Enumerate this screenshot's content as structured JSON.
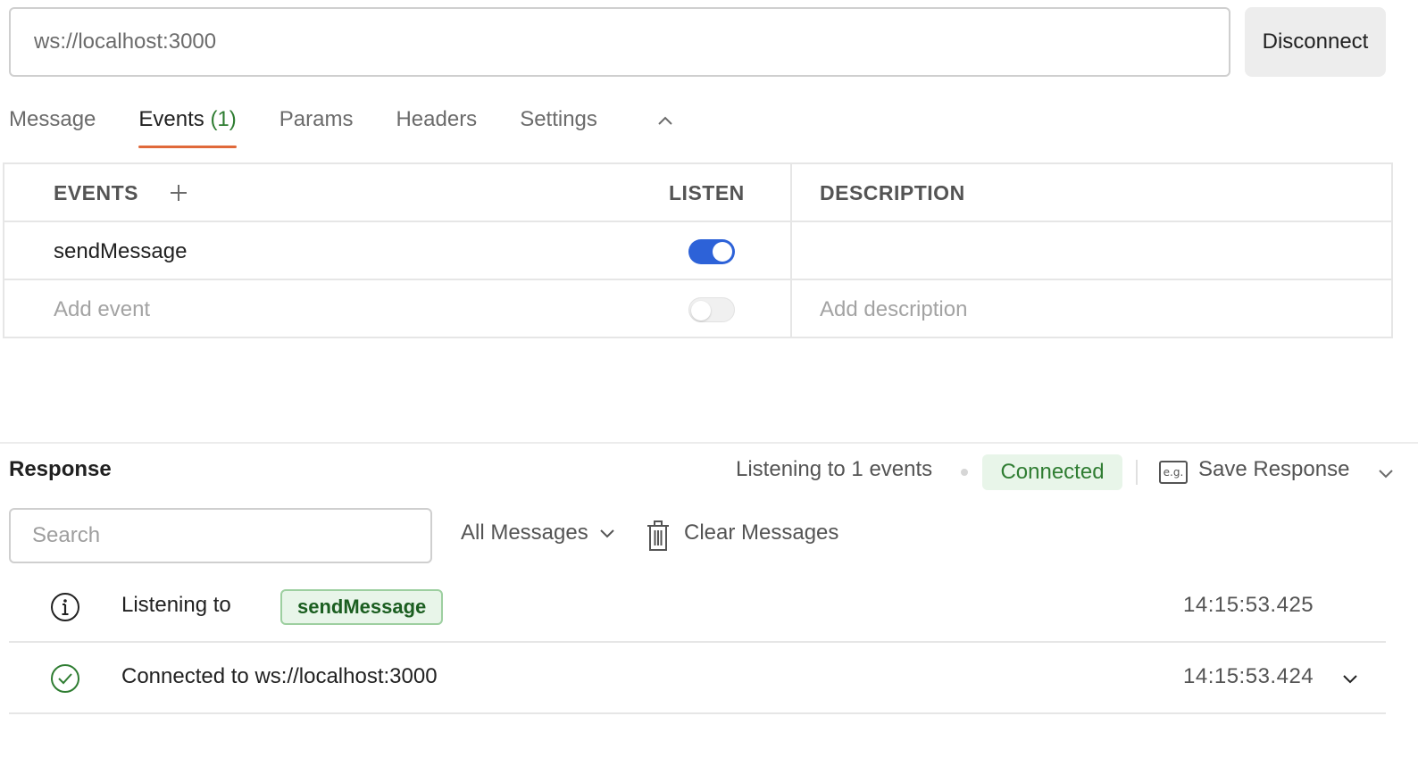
{
  "request": {
    "url": "ws://localhost:3000",
    "disconnect_label": "Disconnect"
  },
  "tabs": [
    {
      "label": "Message",
      "count": ""
    },
    {
      "label": "Events",
      "count": "(1)"
    },
    {
      "label": "Params",
      "count": ""
    },
    {
      "label": "Headers",
      "count": ""
    },
    {
      "label": "Settings",
      "count": ""
    }
  ],
  "active_tab": "Events",
  "events_table": {
    "headers": {
      "events": "EVENTS",
      "listen": "LISTEN",
      "description": "DESCRIPTION"
    },
    "rows": [
      {
        "event": "sendMessage",
        "listen": true,
        "description": ""
      }
    ],
    "new_row": {
      "event_placeholder": "Add event",
      "listen": false,
      "description_placeholder": "Add description"
    }
  },
  "response": {
    "title": "Response",
    "listening_status": "Listening to 1 events",
    "connection_status": "Connected",
    "save_response_label": "Save Response",
    "search_placeholder": "Search",
    "filter_label": "All Messages",
    "clear_label": "Clear Messages",
    "messages": [
      {
        "type": "info",
        "text": "Listening to",
        "event_tag": "sendMessage",
        "time": "14:15:53.425"
      },
      {
        "type": "success",
        "text": "Connected to ws://localhost:3000",
        "time": "14:15:53.424"
      }
    ]
  },
  "colors": {
    "accent_tab": "#e0693a",
    "toggle_on": "#2d62d8",
    "success": "#2f7d32"
  }
}
